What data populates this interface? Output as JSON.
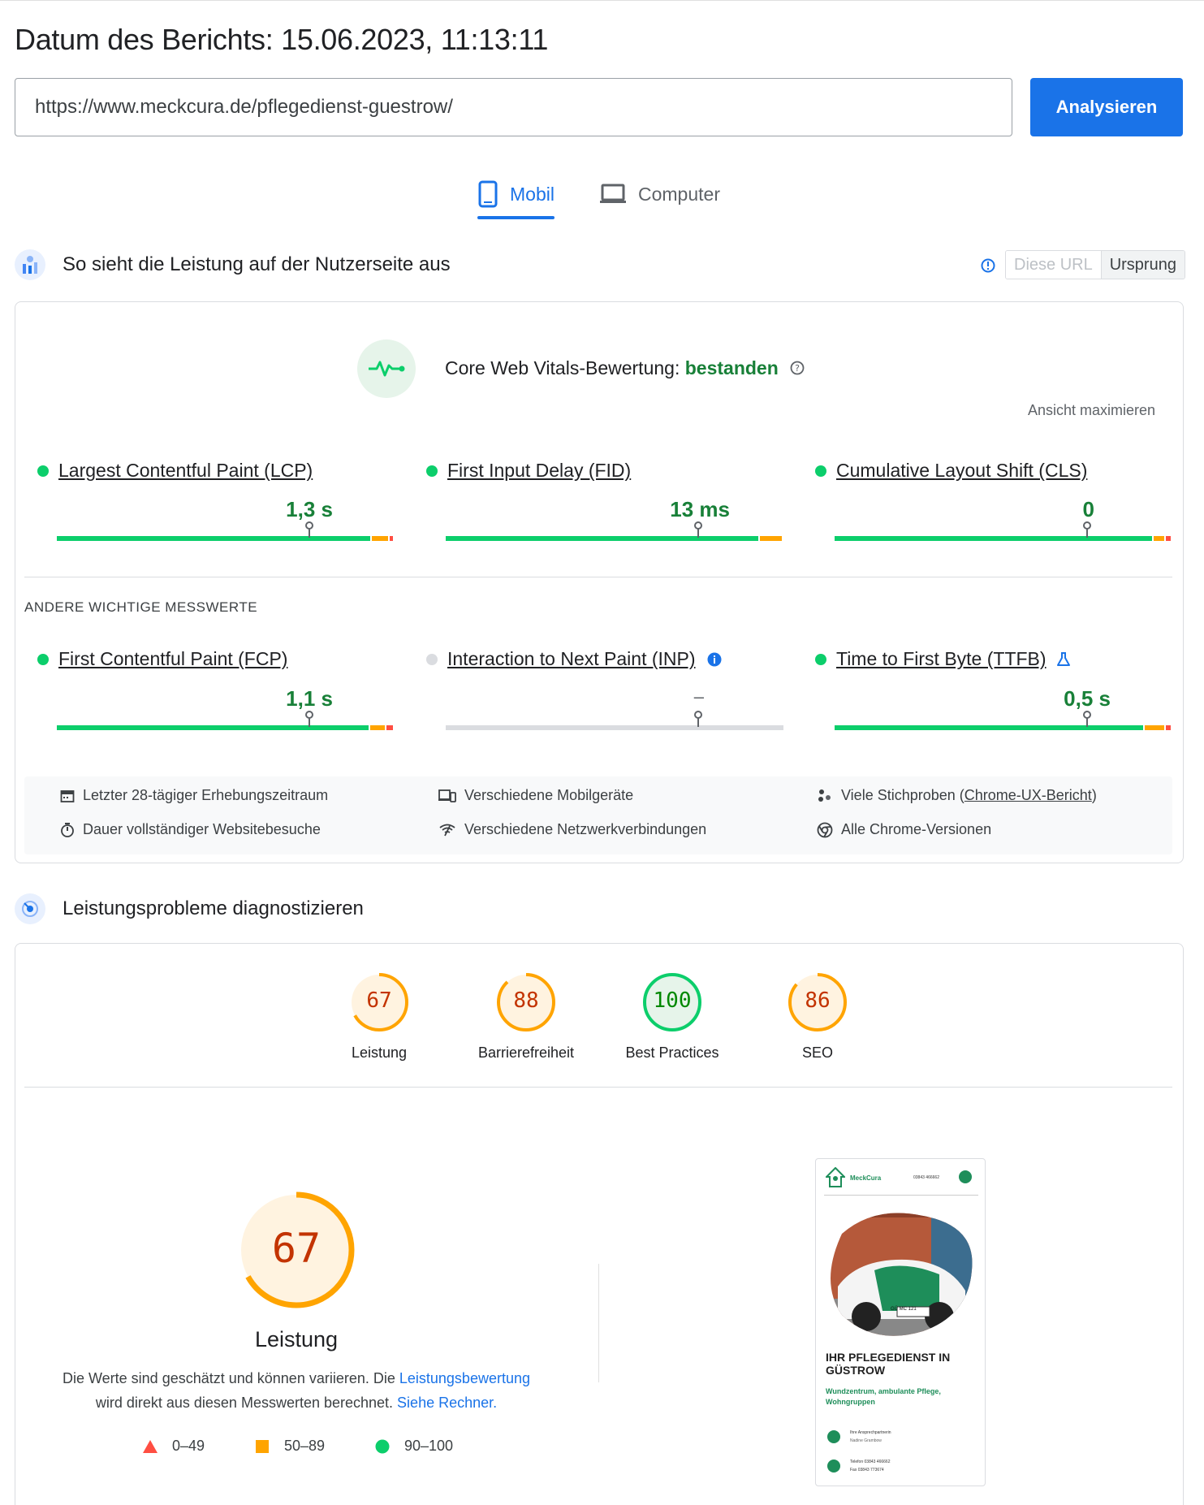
{
  "report": {
    "date_label": "Datum des Berichts: 15.06.2023, 11:13:11"
  },
  "search": {
    "url": "https://www.meckcura.de/pflegedienst-guestrow/",
    "button": "Analysieren"
  },
  "tabs": [
    {
      "label": "Mobil",
      "active": true
    },
    {
      "label": "Computer",
      "active": false
    }
  ],
  "field": {
    "title": "So sieht die Leistung auf der Nutzerseite aus",
    "toggle": {
      "this_url": "Diese URL",
      "origin": "Ursprung"
    },
    "cwv": {
      "label": "Core Web Vitals-Bewertung:",
      "status": "bestanden"
    },
    "maximize": "Ansicht maximieren",
    "core_metrics": [
      {
        "name": "Largest Contentful Paint (LCP)",
        "value": "1,3 s"
      },
      {
        "name": "First Input Delay (FID)",
        "value": "13 ms"
      },
      {
        "name": "Cumulative Layout Shift (CLS)",
        "value": "0"
      }
    ],
    "other_heading": "ANDERE WICHTIGE MESSWERTE",
    "other_metrics": [
      {
        "name": "First Contentful Paint (FCP)",
        "value": "1,1 s"
      },
      {
        "name": "Interaction to Next Paint (INP)",
        "value": "–"
      },
      {
        "name": "Time to First Byte (TTFB)",
        "value": "0,5 s"
      }
    ],
    "info": {
      "period": "Letzter 28-tägiger Erhebungszeitraum",
      "devices": "Verschiedene Mobilgeräte",
      "samples_prefix": "Viele Stichproben (",
      "samples_link": "Chrome-UX-Bericht",
      "samples_suffix": ")",
      "duration": "Dauer vollständiger Websitebesuche",
      "network": "Verschiedene Netzwerkverbindungen",
      "chrome": "Alle Chrome-Versionen"
    }
  },
  "diagnose": {
    "title": "Leistungsprobleme diagnostizieren",
    "scores": [
      {
        "label": "Leistung",
        "value": "67"
      },
      {
        "label": "Barrierefreiheit",
        "value": "88"
      },
      {
        "label": "Best Practices",
        "value": "100"
      },
      {
        "label": "SEO",
        "value": "86"
      }
    ],
    "big": {
      "value": "67",
      "label": "Leistung",
      "note1": "Die Werte sind geschätzt und können variieren. Die ",
      "note_link1": "Leistungsbewertung",
      "note2": "wird direkt aus diesen Messwerten berechnet. ",
      "note_link2": "Siehe Rechner."
    },
    "legend": [
      {
        "range": "0–49"
      },
      {
        "range": "50–89"
      },
      {
        "range": "90–100"
      }
    ]
  },
  "screenshot": {
    "brand": "MeckCura",
    "phone": "03843 466662",
    "hero_title": "IHR PFLEGEDIENST IN GÜSTROW",
    "hero_sub": "Wundzentrum, ambulante Pflege, Wohngruppen",
    "contact_label": "Ihre Ansprechpartnerin",
    "contact_name": "Nadine Grambow",
    "tel_line": "Telefon 03843 466662",
    "fax_line": "Fax 03843 773674",
    "plate": "GÜ MC 121"
  },
  "colors": {
    "accent": "#1a73e8",
    "pass": "#0cce6b",
    "average": "#ffa400",
    "fail": "#ff4e42"
  }
}
